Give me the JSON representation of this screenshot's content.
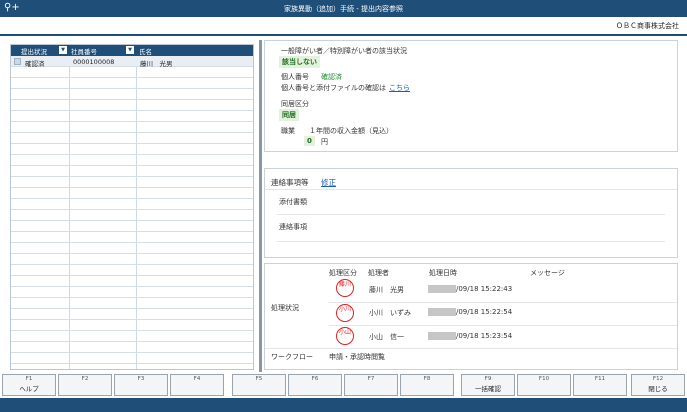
{
  "window": {
    "title": "家族異動（追加）手続 - 提出内容参照",
    "company": "ＯＢＣ商事株式会社"
  },
  "list": {
    "headers": [
      "提出状況",
      "社員番号",
      "氏名"
    ],
    "rows": [
      {
        "status": "確認済",
        "emp_no": "0000100008",
        "name": "藤川　光男"
      }
    ]
  },
  "details": {
    "disability_label": "一般障がい者／特別障がい者の該当状況",
    "disability_value": "該当しない",
    "mynumber_label": "個人番号",
    "mynumber_status": "確認済",
    "mynumber_confirm_label": "個人番号と添付ファイルの確認は",
    "mynumber_confirm_link": "こちら",
    "cohabit_label": "同居区分",
    "cohabit_value": "同居",
    "occupation_label": "職業",
    "income_label": "１年間の収入金額（見込）",
    "income_value": "0",
    "income_unit": "円"
  },
  "contact": {
    "title": "連絡事項等",
    "edit_link": "修正",
    "attach_label": "添付書類",
    "notes_label": "連絡事項"
  },
  "process": {
    "label": "処理状況",
    "headers": [
      "処理区分",
      "処理者",
      "処理日時",
      "メッセージ"
    ],
    "rows": [
      {
        "stamp": "藤川",
        "name": "藤川　光男",
        "date": "/09/18 15:22:43"
      },
      {
        "stamp": "小川",
        "name": "小川　いずみ",
        "date": "/09/18 15:22:54"
      },
      {
        "stamp": "小山",
        "name": "小山　信一",
        "date": "/09/18 15:23:54"
      }
    ],
    "workflow_label": "ワークフロー",
    "workflow_value": "申請・承認時閲覧"
  },
  "fkeys": [
    {
      "key": "F1",
      "label": "ヘルプ"
    },
    {
      "key": "F2",
      "label": ""
    },
    {
      "key": "F3",
      "label": ""
    },
    {
      "key": "F4",
      "label": ""
    },
    {
      "key": "F5",
      "label": ""
    },
    {
      "key": "F6",
      "label": ""
    },
    {
      "key": "F7",
      "label": ""
    },
    {
      "key": "F8",
      "label": ""
    },
    {
      "key": "F9",
      "label": "一括確認"
    },
    {
      "key": "F10",
      "label": ""
    },
    {
      "key": "F11",
      "label": ""
    },
    {
      "key": "F12",
      "label": "閉じる"
    }
  ]
}
